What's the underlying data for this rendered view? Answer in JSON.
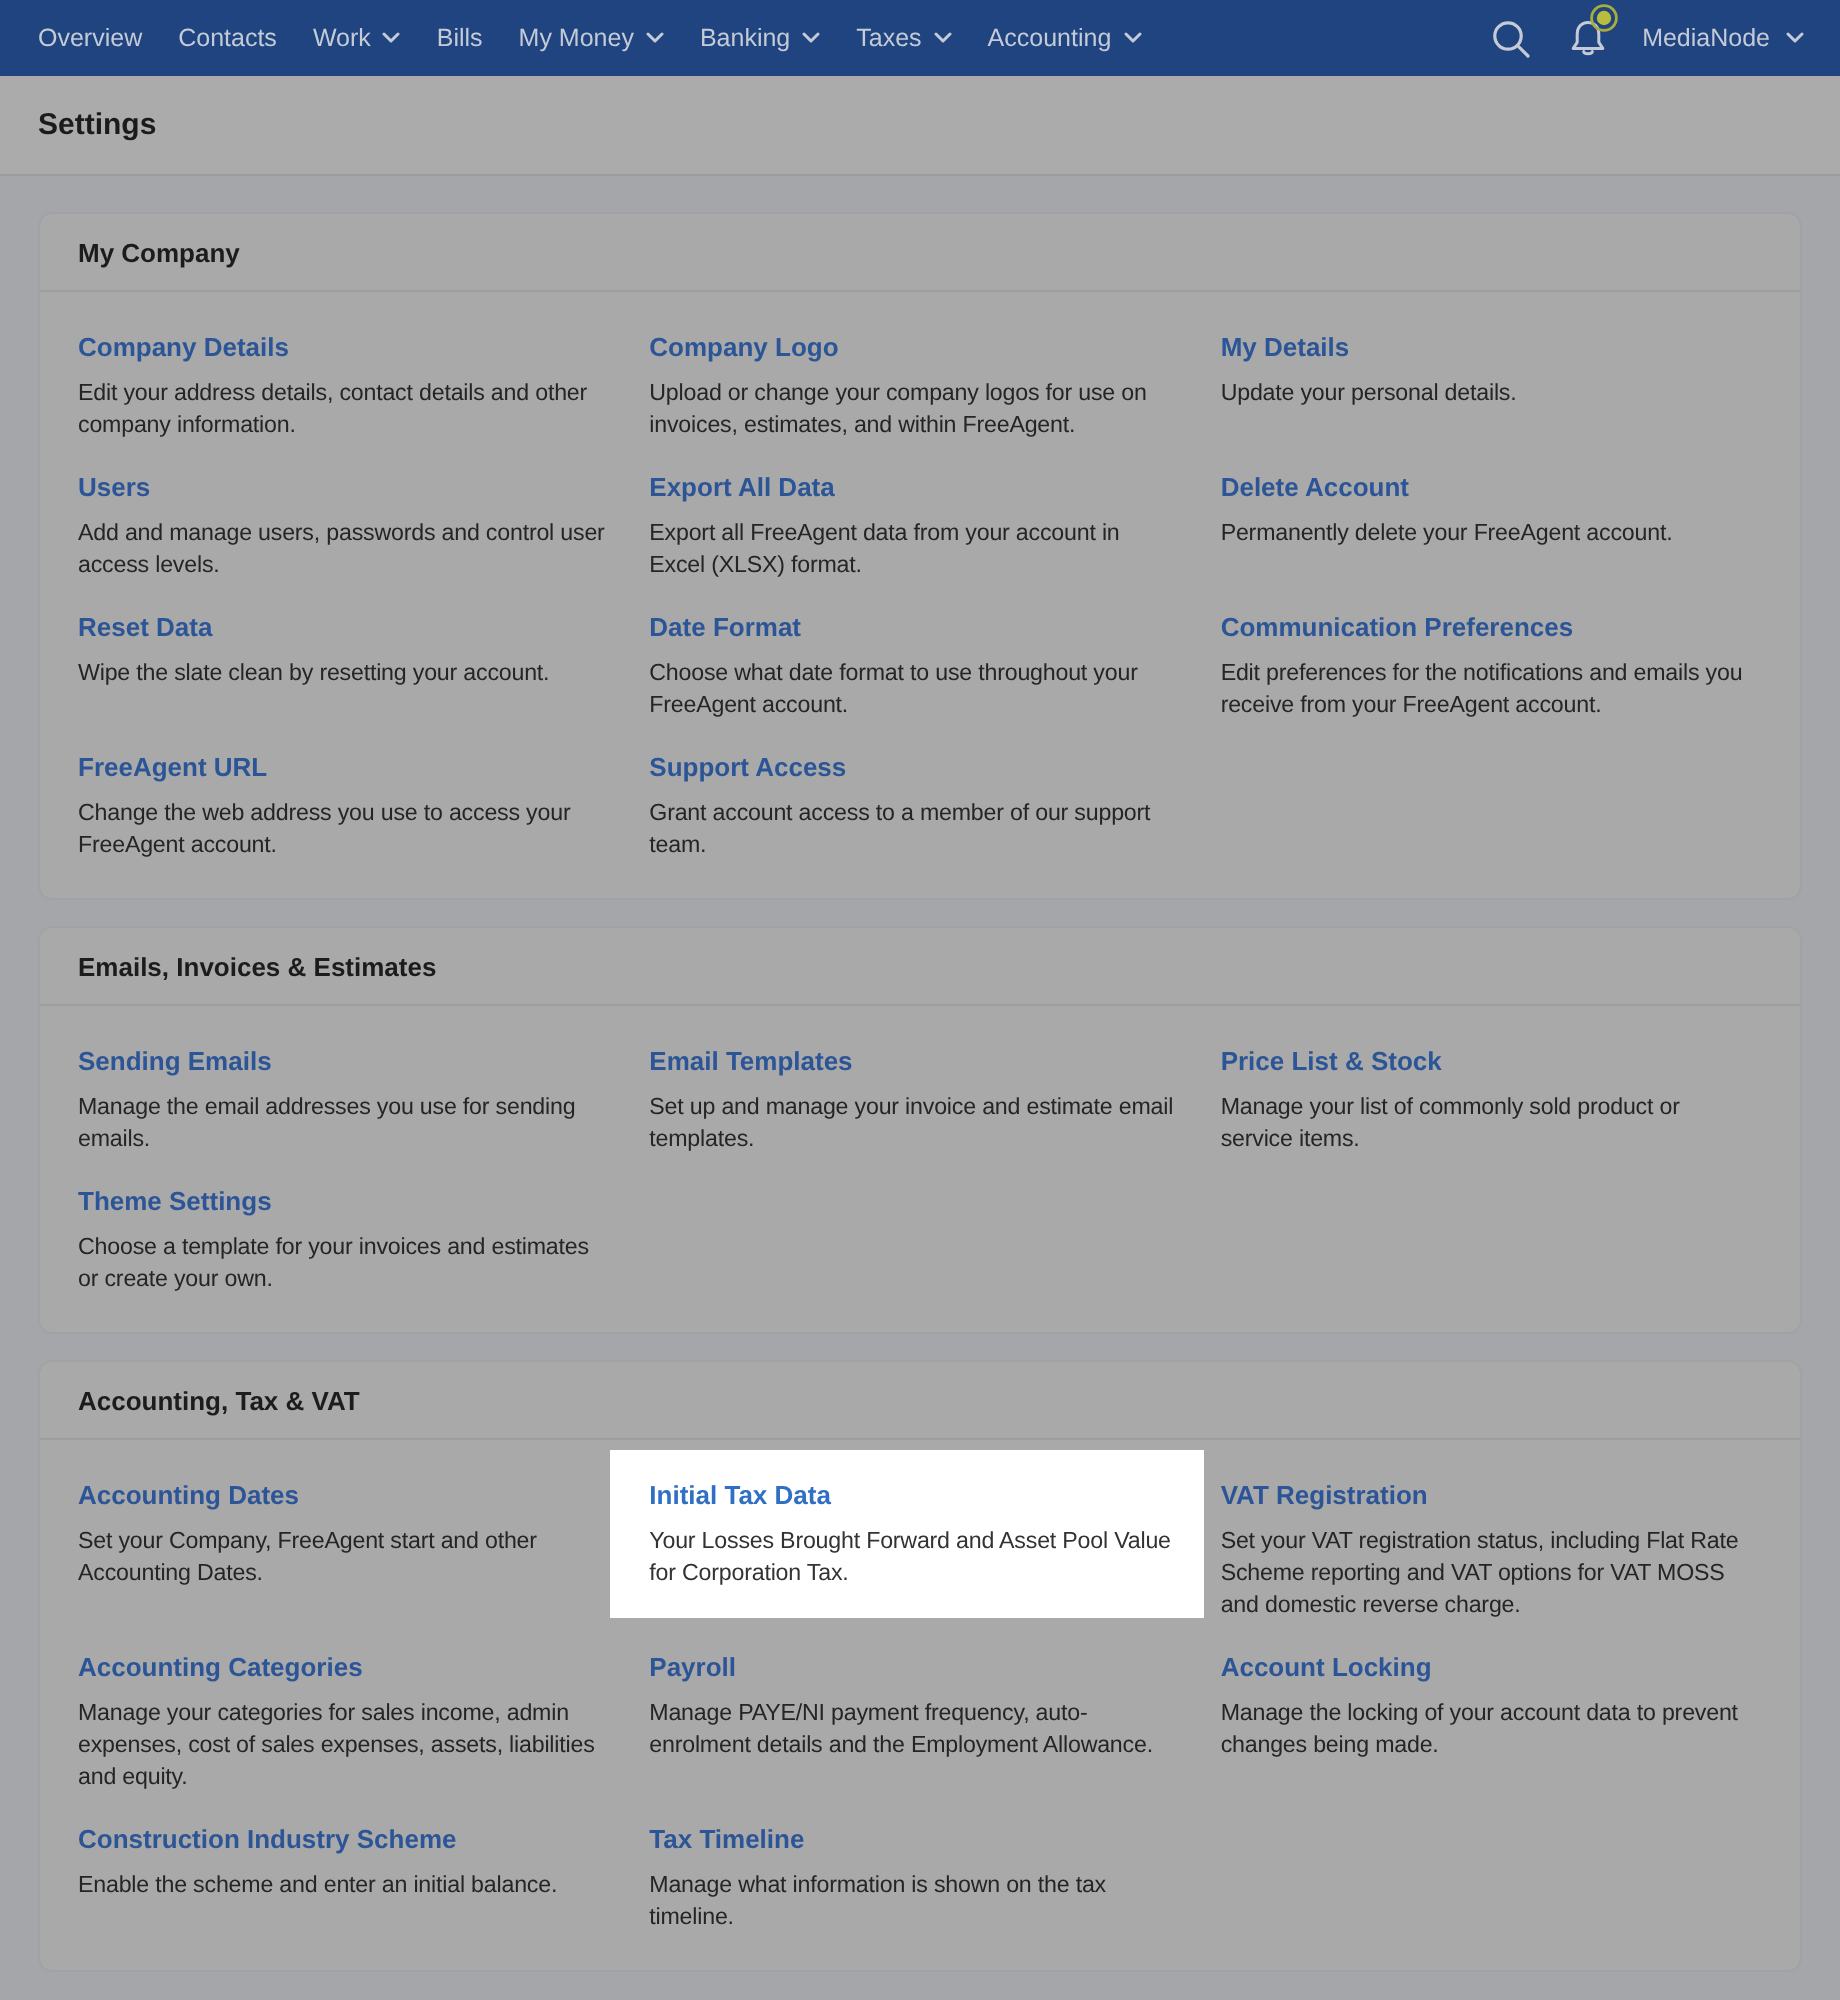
{
  "nav": {
    "items": [
      {
        "label": "Overview",
        "dropdown": false
      },
      {
        "label": "Contacts",
        "dropdown": false
      },
      {
        "label": "Work",
        "dropdown": true
      },
      {
        "label": "Bills",
        "dropdown": false
      },
      {
        "label": "My Money",
        "dropdown": true
      },
      {
        "label": "Banking",
        "dropdown": true
      },
      {
        "label": "Taxes",
        "dropdown": true
      },
      {
        "label": "Accounting",
        "dropdown": true
      }
    ],
    "notification_beacon": true,
    "account": {
      "label": "MediaNode",
      "dropdown": true
    }
  },
  "page_title": "Settings",
  "sections": [
    {
      "title": "My Company",
      "items": [
        {
          "title": "Company Details",
          "description": "Edit your address details, contact details and other company information.",
          "highlighted": false
        },
        {
          "title": "Company Logo",
          "description": "Upload or change your company logos for use on invoices, estimates, and within FreeAgent.",
          "highlighted": false
        },
        {
          "title": "My Details",
          "description": "Update your personal details.",
          "highlighted": false
        },
        {
          "title": "Users",
          "description": "Add and manage users, passwords and control user access levels.",
          "highlighted": false
        },
        {
          "title": "Export All Data",
          "description": "Export all FreeAgent data from your account in Excel (XLSX) format.",
          "highlighted": false
        },
        {
          "title": "Delete Account",
          "description": "Permanently delete your FreeAgent account.",
          "highlighted": false
        },
        {
          "title": "Reset Data",
          "description": "Wipe the slate clean by resetting your account.",
          "highlighted": false
        },
        {
          "title": "Date Format",
          "description": "Choose what date format to use throughout your FreeAgent account.",
          "highlighted": false
        },
        {
          "title": "Communication Preferences",
          "description": "Edit preferences for the notifications and emails you receive from your FreeAgent account.",
          "highlighted": false
        },
        {
          "title": "FreeAgent URL",
          "description": "Change the web address you use to access your FreeAgent account.",
          "highlighted": false
        },
        {
          "title": "Support Access",
          "description": "Grant account access to a member of our support team.",
          "highlighted": false
        }
      ]
    },
    {
      "title": "Emails, Invoices & Estimates",
      "items": [
        {
          "title": "Sending Emails",
          "description": "Manage the email addresses you use for sending emails.",
          "highlighted": false
        },
        {
          "title": "Email Templates",
          "description": "Set up and manage your invoice and estimate email templates.",
          "highlighted": false
        },
        {
          "title": "Price List & Stock",
          "description": "Manage your list of commonly sold product or service items.",
          "highlighted": false
        },
        {
          "title": "Theme Settings",
          "description": "Choose a template for your invoices and estimates or create your own.",
          "highlighted": false
        }
      ]
    },
    {
      "title": "Accounting, Tax & VAT",
      "items": [
        {
          "title": "Accounting Dates",
          "description": "Set your Company, FreeAgent start and other Accounting Dates.",
          "highlighted": false
        },
        {
          "title": "Initial Tax Data",
          "description": "Your Losses Brought Forward and Asset Pool Value for Corporation Tax.",
          "highlighted": true
        },
        {
          "title": "VAT Registration",
          "description": "Set your VAT registration status, including Flat Rate Scheme reporting and VAT options for VAT MOSS and domestic reverse charge.",
          "highlighted": false
        },
        {
          "title": "Accounting Categories",
          "description": "Manage your categories for sales income, admin expenses, cost of sales expenses, assets, liabilities and equity.",
          "highlighted": false
        },
        {
          "title": "Payroll",
          "description": "Manage PAYE/NI payment frequency, auto-enrolment details and the Employment Allowance.",
          "highlighted": false
        },
        {
          "title": "Account Locking",
          "description": "Manage the locking of your account data to prevent changes being made.",
          "highlighted": false
        },
        {
          "title": "Construction Industry Scheme",
          "description": "Enable the scheme and enter an initial balance.",
          "highlighted": false
        },
        {
          "title": "Tax Timeline",
          "description": "Manage what information is shown on the tax timeline.",
          "highlighted": false
        }
      ]
    }
  ]
}
